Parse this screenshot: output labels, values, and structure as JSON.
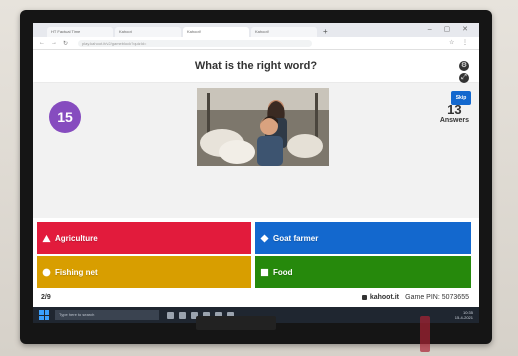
{
  "browser": {
    "tabs": [
      {
        "label": "HT Factual Time",
        "active": false
      },
      {
        "label": "Kahoot",
        "active": false
      },
      {
        "label": "Kahoot!",
        "active": true
      },
      {
        "label": "Kahoot!",
        "active": false
      }
    ],
    "url": "play.kahoot.it/v2/gameblock?quizId=",
    "new_tab": "+",
    "window_controls": "– ▢ ✕",
    "nav": {
      "back": "←",
      "forward": "→",
      "reload": "↻"
    }
  },
  "question": {
    "text": "What is the right word?"
  },
  "side_controls": {
    "top_icon": "settings-icon",
    "bottom_icon": "fullscreen-icon",
    "skip_label": "Skip"
  },
  "timer": {
    "value": "15"
  },
  "answers": {
    "count": "13",
    "label": "Answers"
  },
  "choices": [
    {
      "label": "Agriculture",
      "shape": "triangle",
      "color": "#e21b3c"
    },
    {
      "label": "Goat farmer",
      "shape": "diamond",
      "color": "#1368ce"
    },
    {
      "label": "Fishing net",
      "shape": "circle",
      "color": "#d89e00"
    },
    {
      "label": "Food",
      "shape": "square",
      "color": "#26890c"
    }
  ],
  "footer": {
    "counter": "2/9",
    "site": "kahoot.it",
    "game_pin": "Game PIN: 5073655"
  },
  "taskbar": {
    "search_placeholder": "Type here to search",
    "time": "10:35",
    "date": "15-4-2021"
  }
}
